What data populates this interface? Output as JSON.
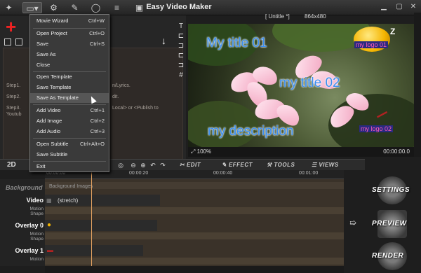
{
  "window": {
    "title": "Easy Video Maker",
    "project": "[ Untitle *]",
    "resolution": "864x480"
  },
  "menu": {
    "items": [
      {
        "label": "Movie Wizard",
        "shortcut": "Ctrl+W"
      },
      {
        "label": "Open Project",
        "shortcut": "Ctrl+O"
      },
      {
        "label": "Save",
        "shortcut": "Ctrl+S"
      },
      {
        "label": "Save As",
        "shortcut": ""
      },
      {
        "label": "Close",
        "shortcut": ""
      },
      {
        "label": "Open Template",
        "shortcut": ""
      },
      {
        "label": "Save Template",
        "shortcut": ""
      },
      {
        "label": "Save As Template",
        "shortcut": ""
      },
      {
        "label": "Add Video",
        "shortcut": "Ctrl+1"
      },
      {
        "label": "Add Image",
        "shortcut": "Ctrl+2"
      },
      {
        "label": "Add Audio",
        "shortcut": "Ctrl+3"
      },
      {
        "label": "Open Subtitle",
        "shortcut": "Ctrl+Alt+O"
      },
      {
        "label": "Save Subtitle",
        "shortcut": ""
      },
      {
        "label": "Exit",
        "shortcut": ""
      }
    ]
  },
  "steps": {
    "step1": "Step1.",
    "step1_tail": "n/Lyrics.",
    "step2": "Step2.",
    "step2_tail": "dit.",
    "step3": "Step3.",
    "step3_tail": "Local> or <Publish to",
    "step3_line2": "Youtub"
  },
  "preview": {
    "title1": "My title 01",
    "title2": "my title 02",
    "description": "my description",
    "logo1": "my logo 01",
    "logo2": "my logo 02",
    "zoom": "100%",
    "time": "00:00:00.0"
  },
  "toolbar": {
    "mode": "2D",
    "edit": "EDIT",
    "effect": "EFFECT",
    "tools": "TOOLS",
    "views": "VIEWS"
  },
  "timeline": {
    "ticks": [
      "00:00:00",
      "00:00:20",
      "00:00:40",
      "00:01:00"
    ],
    "background_label": "Background",
    "background_images": "Background Images",
    "tracks": [
      {
        "name": "Video",
        "sub1": "Motion",
        "sub2": "Shape",
        "clip": "(stretch)"
      },
      {
        "name": "Overlay 0",
        "sub1": "Motion",
        "sub2": "Shape",
        "clip": ""
      },
      {
        "name": "Overlay 1",
        "sub1": "Motion",
        "sub2": "",
        "clip": ""
      }
    ]
  },
  "side_buttons": {
    "settings": "SETTINGS",
    "preview": "PREVIEW",
    "render": "RENDER"
  }
}
